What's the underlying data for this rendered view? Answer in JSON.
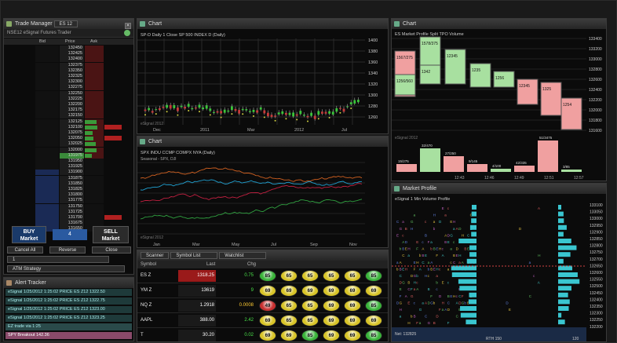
{
  "trade_manager": {
    "title": "Trade Manager",
    "instrument": "ES 12",
    "strategy_label": "NSE12  eSignal Futures Trader",
    "col_headers": [
      "Bid",
      "Price",
      "Ask"
    ],
    "prices": [
      "132450",
      "132425",
      "132400",
      "132375",
      "132350",
      "132325",
      "132300",
      "132275",
      "132250",
      "132225",
      "132200",
      "132175",
      "132150",
      "132125",
      "132100",
      "132075",
      "132050",
      "132025",
      "132000",
      "131975",
      "131950",
      "131925",
      "131900",
      "131875",
      "131850",
      "131825",
      "131800",
      "131775",
      "131750",
      "131725",
      "131700",
      "131675",
      "131650"
    ],
    "buy_label": "BUY",
    "buy_sub": "Market",
    "sell_label": "SELL",
    "sell_sub": "Market",
    "qty_value": "4",
    "order_buttons": [
      "Cancel All",
      "Reverse",
      "Close"
    ],
    "strategy_value": "ATM Strategy",
    "account_value": "1"
  },
  "chart1": {
    "title": "Chart",
    "header_text": "SP-D Daily  1 Close  SP 500 INDEX  D  (Daily)",
    "x_labels": [
      "Dec",
      "2011",
      "Mar",
      "2012",
      "Jul"
    ],
    "y_labels": [
      "1400",
      "1380",
      "1360",
      "1340",
      "1320",
      "1300",
      "1280",
      "1260"
    ],
    "footer": "eSignal 2012"
  },
  "chart2": {
    "title": "Chart",
    "header_text": "SPX  INDU  CCMP  COMPX  NYA  (Daily)",
    "sub_text": "Seasonal  -  SPX, DJI",
    "x_labels": [
      "Jan",
      "Mar",
      "May",
      "Jul",
      "Sep",
      "Nov"
    ],
    "series_colors": [
      "#d06020",
      "#20a0d0",
      "#c02040",
      "#30a040"
    ],
    "footer": "eSignal 2012"
  },
  "market_profile": {
    "title": "Chart",
    "header_text": "ES  Market Profile  Split  TPO  Volume",
    "y_labels": [
      "133400",
      "133200",
      "133000",
      "132800",
      "132600",
      "132400",
      "132200",
      "132000",
      "131800",
      "131600"
    ],
    "x_labels": [
      "12:43",
      "12:46",
      "12:49",
      "12:51",
      "12:57"
    ],
    "footer": "eSignal 2012",
    "boxes": [
      "1567/275",
      "1256/560",
      "1578/375",
      "1342",
      "12345",
      "1235",
      "1256",
      "12345",
      "1325",
      "1254",
      "1324/75",
      "1385",
      "1328",
      "12364",
      "12352",
      "12345"
    ],
    "vol_labels": [
      "15/275",
      "32/470",
      "27/250",
      "9/145",
      "4/100",
      "42/335",
      "51/3475",
      "3/85"
    ]
  },
  "volume_profile": {
    "title": "Market Profile",
    "header_text": "eSignal 1 Min Volume Profile",
    "y_labels": [
      "133100",
      "133050",
      "133000",
      "132950",
      "132900",
      "132850",
      "132800",
      "132750",
      "132700",
      "132650",
      "132600",
      "132550",
      "132500",
      "132450",
      "132400",
      "132350",
      "132300",
      "132250",
      "132200"
    ],
    "footer_left": "Net: 132825",
    "footer_mid": "RTH 150",
    "footer_right": "120"
  },
  "scanner": {
    "tabs": [
      "Scanner",
      "Symbol List",
      "Watchlist"
    ],
    "col_headers": [
      "Symbol",
      "Last",
      "Chg"
    ],
    "rows": [
      {
        "symbol": "ES Z",
        "last": "1318.25",
        "chg": "0.75",
        "gauges": [
          "85",
          "65",
          "65",
          "65",
          "65",
          "85"
        ]
      },
      {
        "symbol": "YM Z",
        "last": "13619",
        "chg": "9",
        "gauges": [
          "69",
          "69",
          "69",
          "69",
          "69",
          "69"
        ]
      },
      {
        "symbol": "NQ Z",
        "last": "1.2918",
        "chg": "0.0008",
        "gauges": [
          "49",
          "65",
          "65",
          "69",
          "69",
          "85"
        ]
      },
      {
        "symbol": "AAPL",
        "last": "388.00",
        "chg": "2.42",
        "gauges": [
          "69",
          "65",
          "65",
          "69",
          "69",
          "69"
        ]
      },
      {
        "symbol": "T",
        "last": "30.20",
        "chg": "0.02",
        "gauges": [
          "69",
          "69",
          "85",
          "69",
          "69",
          "85"
        ]
      }
    ]
  },
  "alerts": {
    "title": "Alert Tracker",
    "lines": [
      "eSignal  1/25/2012  1:25:02  PRICE  ES Z12  1322.50",
      "eSignal  1/25/2012  1:25:02  PRICE  ES Z12  1322.75",
      "eSignal  1/25/2012  1:25:02  PRICE  ES Z12  1323.00",
      "eSignal  1/25/2012  1:25:02  PRICE  ES Z12  1323.25",
      "EZ trade via 1:25",
      "SPY  Breakout  142.36"
    ]
  }
}
